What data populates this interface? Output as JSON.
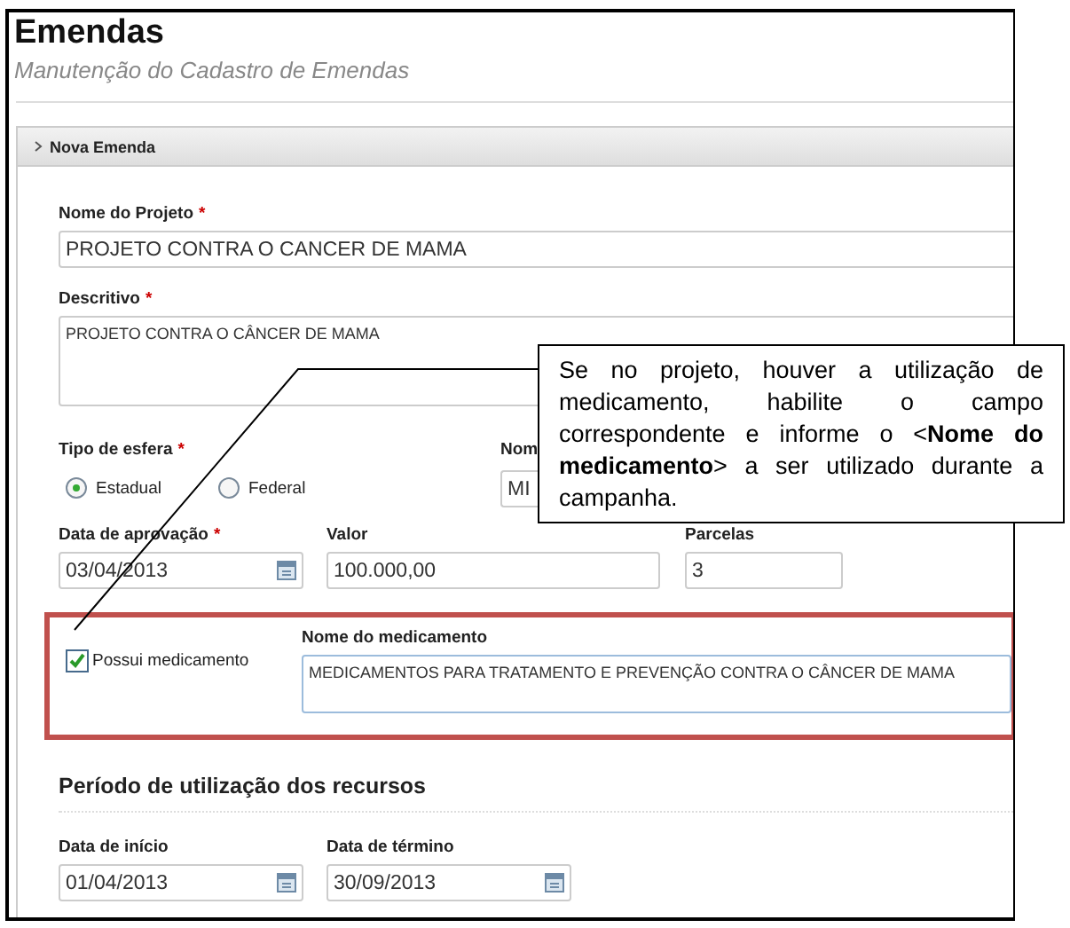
{
  "header": {
    "title": "Emendas",
    "subtitle": "Manutenção do Cadastro de Emendas"
  },
  "panel": {
    "title": "Nova Emenda"
  },
  "project_name": {
    "label": "Nome do Projeto",
    "mark": "*",
    "value": "PROJETO CONTRA O CANCER DE MAMA"
  },
  "description": {
    "label": "Descritivo",
    "mark": "*",
    "value": "PROJETO CONTRA O CÂNCER DE MAMA"
  },
  "sphere": {
    "label": "Tipo de esfera",
    "mark": "*",
    "options": [
      {
        "label": "Estadual",
        "selected": true
      },
      {
        "label": "Federal",
        "selected": false
      }
    ]
  },
  "column_2": {
    "label": "Nom",
    "value": "MI"
  },
  "row_fields": [
    {
      "kind": "date",
      "label": "Data de aprovação",
      "mark": "*",
      "value": "03/04/2013"
    },
    {
      "kind": "text",
      "label": "Valor",
      "value": "100.000,00"
    },
    {
      "kind": "text",
      "label": "Parcelas",
      "value": "3"
    }
  ],
  "medication": {
    "checkbox_label": "Possui medicamento",
    "checked": true,
    "highlighted": true,
    "label": "Nome do medicamento",
    "value": "MEDICAMENTOS PARA TRATAMENTO E PREVENÇÃO CONTRA O CÂNCER DE MAMA"
  },
  "period": {
    "title": "Período de utilização dos recursos",
    "fields": [
      {
        "kind": "date",
        "label": "Data de início",
        "value": "01/04/2013"
      },
      {
        "kind": "date",
        "label": "Data de término",
        "value": "30/09/2013"
      }
    ]
  },
  "callout": {
    "text": "Se no projeto, houver a utilização de medicamento, habilite o campo correspondente e informe o <**Nome do medicamento**> a ser utilizado durante a campanha."
  }
}
